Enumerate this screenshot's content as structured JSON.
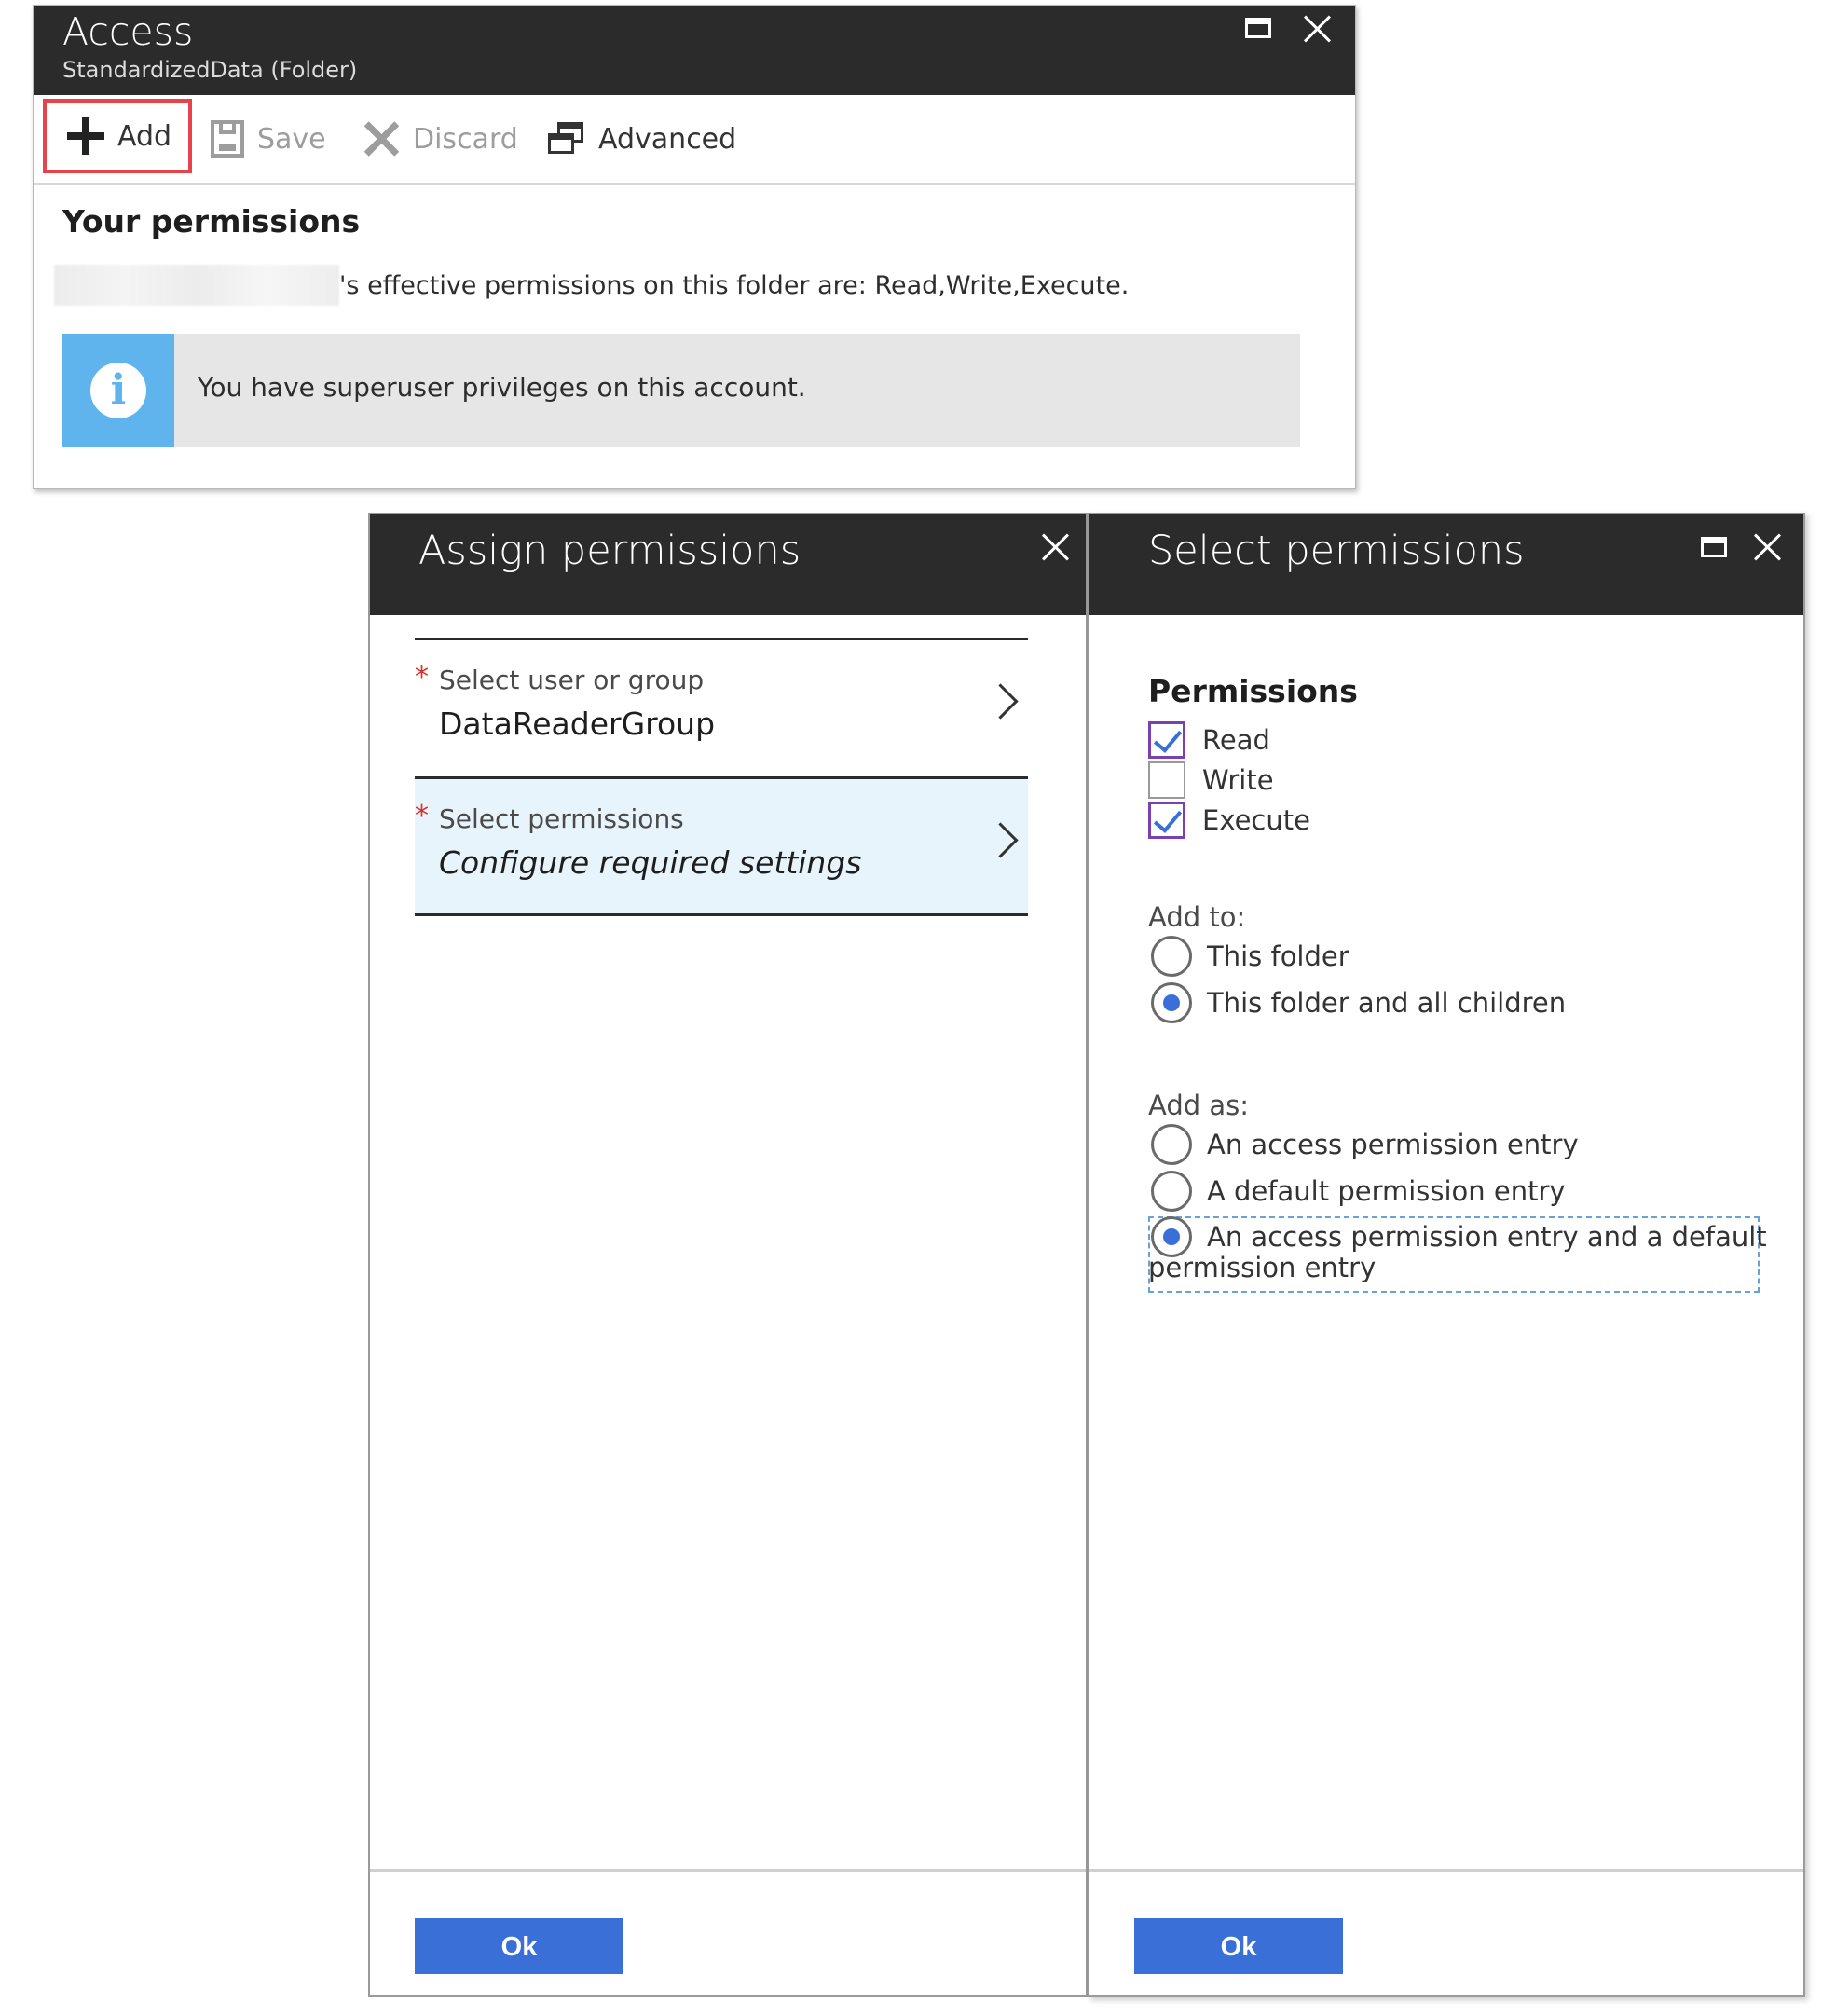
{
  "access": {
    "title": "Access",
    "subtitle": "StandardizedData (Folder)",
    "toolbar": {
      "add_label": "Add",
      "save_label": "Save",
      "discard_label": "Discard",
      "advanced_label": "Advanced"
    },
    "your_permissions_title": "Your permissions",
    "effective_text": "'s effective permissions on this folder are: Read,Write,Execute.",
    "info_banner_text": "You have superuser privileges on this account."
  },
  "assign": {
    "title": "Assign permissions",
    "fields": [
      {
        "label": "Select user or group",
        "value": "DataReaderGroup"
      },
      {
        "label": "Select permissions",
        "value": "Configure required settings"
      }
    ],
    "ok_label": "Ok"
  },
  "select": {
    "title": "Select permissions",
    "permissions_heading": "Permissions",
    "permissions": [
      {
        "label": "Read",
        "checked": true
      },
      {
        "label": "Write",
        "checked": false
      },
      {
        "label": "Execute",
        "checked": true
      }
    ],
    "add_to_label": "Add to:",
    "add_to_options": [
      {
        "label": "This folder",
        "selected": false
      },
      {
        "label": "This folder and all children",
        "selected": true
      }
    ],
    "add_as_label": "Add as:",
    "add_as_options": [
      {
        "label": "An access permission entry",
        "selected": false
      },
      {
        "label": "A default permission entry",
        "selected": false
      },
      {
        "label": "An access permission entry and a default",
        "label_line2": "permission entry",
        "selected": true
      }
    ],
    "ok_label": "Ok"
  },
  "colors": {
    "header_bg": "#2b2b2b",
    "accent": "#3b6fd8",
    "info_blue": "#5fb4ee",
    "highlight_red": "#e8434a",
    "selected_field_bg": "#e8f4fb"
  }
}
